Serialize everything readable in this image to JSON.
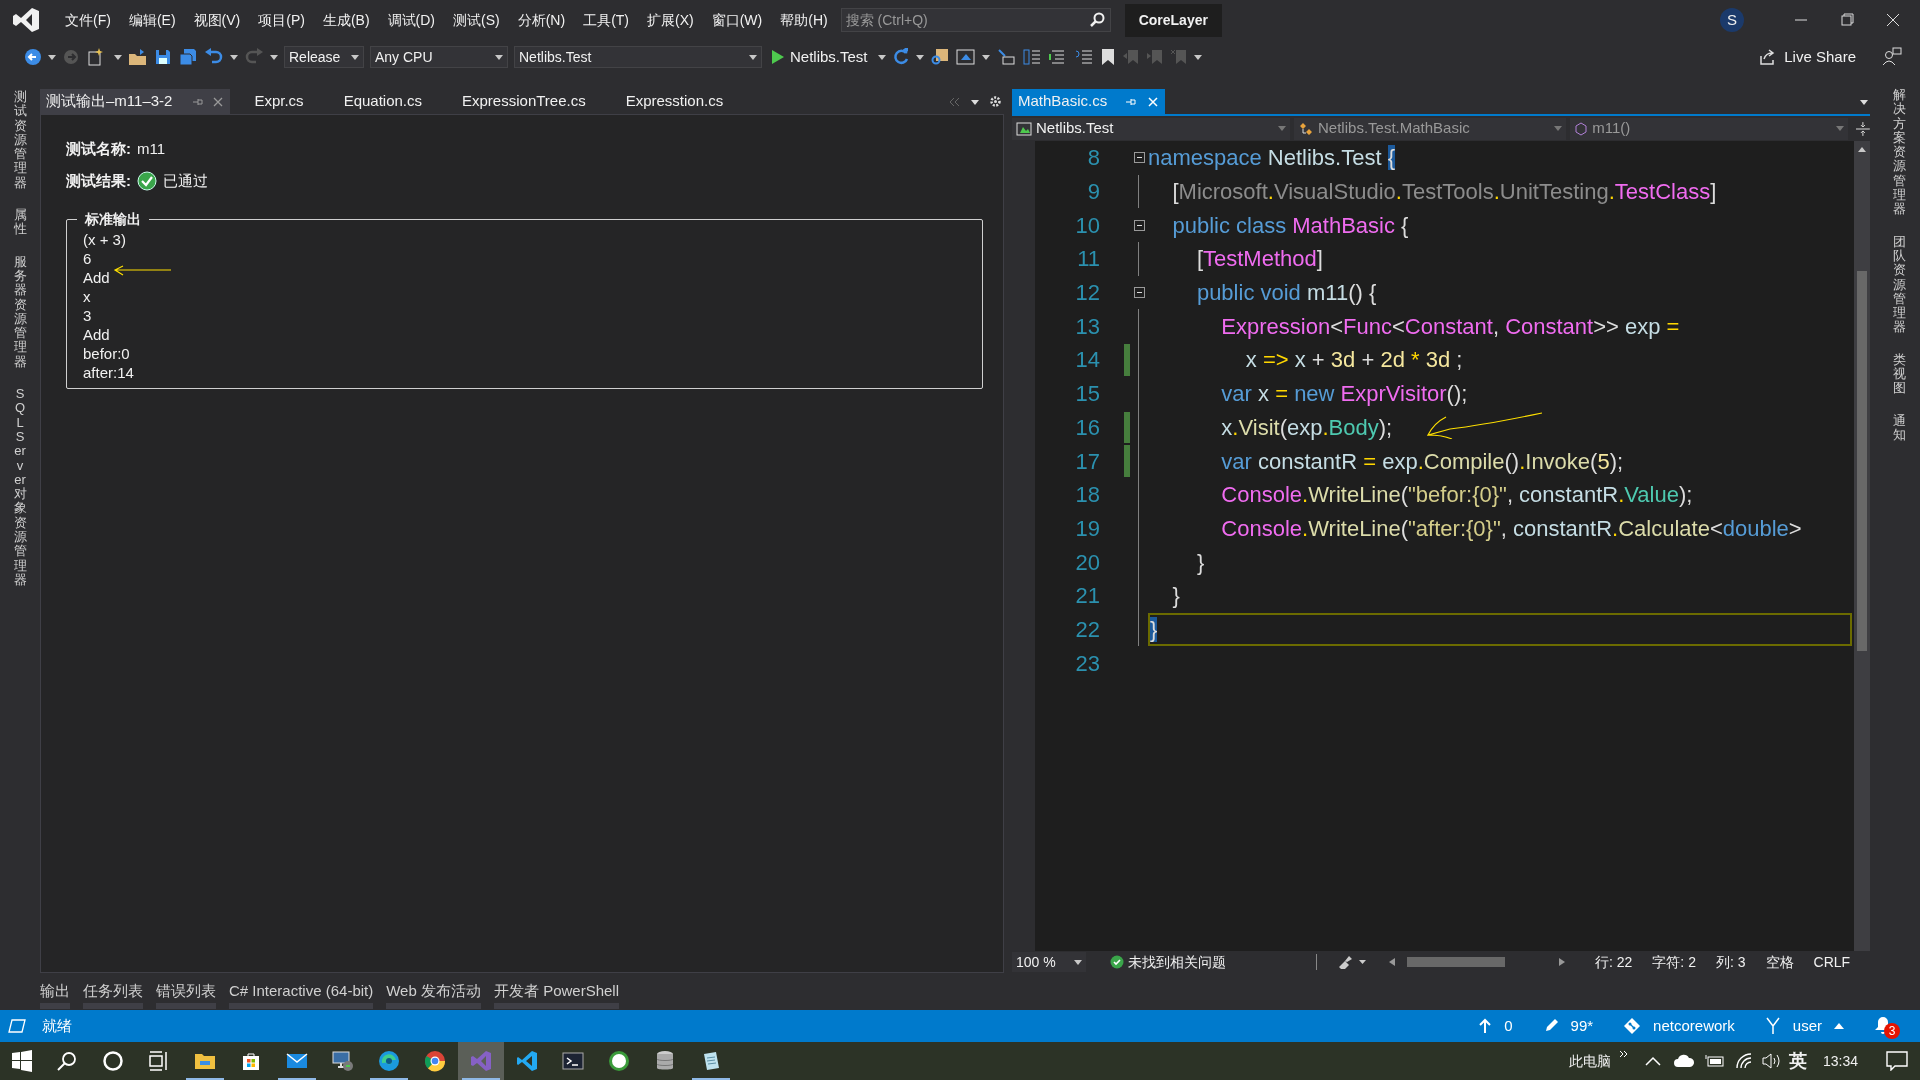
{
  "title_bar": {
    "menu": [
      "文件(F)",
      "编辑(E)",
      "视图(V)",
      "项目(P)",
      "生成(B)",
      "调试(D)",
      "测试(S)",
      "分析(N)",
      "工具(T)",
      "扩展(X)",
      "窗口(W)",
      "帮助(H)"
    ],
    "search": {
      "placeholder": "搜索 (Ctrl+Q)"
    },
    "solution": "CoreLayer",
    "account_initial": "S"
  },
  "toolbar": {
    "configuration": "Release",
    "platform": "Any CPU",
    "startup_project": "Netlibs.Test",
    "run_target": "Netlibs.Test",
    "live_share": "Live Share"
  },
  "left_tool_tabs": [
    "测试资源管理器",
    "属性",
    "服务器资源管理器",
    "SQL Server 对象资源管理器"
  ],
  "right_tool_tabs": [
    "解决方案资源管理器",
    "团队资源管理器",
    "类视图",
    "通知"
  ],
  "output_pane": {
    "tabs": [
      {
        "label": "测试输出–m11–3-2",
        "selected": true
      },
      {
        "label": "Expr.cs",
        "selected": false
      },
      {
        "label": "Equation.cs",
        "selected": false
      },
      {
        "label": "ExpressionTree.cs",
        "selected": false
      },
      {
        "label": "Expresstion.cs",
        "selected": false
      }
    ],
    "test_name": {
      "label": "测试名称:",
      "value": "m11"
    },
    "test_result": {
      "label": "测试结果:",
      "value": "已通过",
      "passed": true
    },
    "stdout": {
      "title": "标准输出",
      "lines": [
        "(x + 3)",
        "6",
        "Add",
        "x",
        "3",
        "Add",
        "befor:0",
        "after:14"
      ]
    }
  },
  "editor": {
    "tabs": [
      {
        "label": "MathBasic.cs",
        "selected": true
      }
    ],
    "nav": [
      {
        "kind": "project",
        "label": "Netlibs.Test"
      },
      {
        "kind": "class",
        "label": "Netlibs.Test.MathBasic"
      },
      {
        "kind": "method",
        "label": "m11()"
      }
    ],
    "lines": [
      {
        "number": "8",
        "fold": true,
        "changed": false,
        "current": false,
        "tokens": [
          {
            "kind": "kw",
            "text": "namespace"
          },
          {
            "kind": "id",
            "text": " Netlibs.Test "
          },
          {
            "kind": "brace",
            "text": "{"
          }
        ]
      },
      {
        "number": "9",
        "fold": false,
        "changed": false,
        "current": false,
        "tokens": [
          {
            "kind": "punct",
            "text": "    ["
          },
          {
            "kind": "ns",
            "text": "Microsoft"
          },
          {
            "kind": "op",
            "text": "."
          },
          {
            "kind": "ns",
            "text": "VisualStudio"
          },
          {
            "kind": "op",
            "text": "."
          },
          {
            "kind": "ns",
            "text": "TestTools"
          },
          {
            "kind": "op",
            "text": "."
          },
          {
            "kind": "ns",
            "text": "UnitTesting"
          },
          {
            "kind": "op",
            "text": "."
          },
          {
            "kind": "type",
            "text": "TestClass"
          },
          {
            "kind": "punct",
            "text": "]"
          }
        ]
      },
      {
        "number": "10",
        "fold": true,
        "changed": false,
        "current": false,
        "tokens": [
          {
            "kind": "kw",
            "text": "    public class "
          },
          {
            "kind": "type",
            "text": "MathBasic"
          },
          {
            "kind": "punct",
            "text": " {"
          }
        ]
      },
      {
        "number": "11",
        "fold": false,
        "changed": false,
        "current": false,
        "tokens": [
          {
            "kind": "punct",
            "text": "        ["
          },
          {
            "kind": "type",
            "text": "TestMethod"
          },
          {
            "kind": "punct",
            "text": "]"
          }
        ]
      },
      {
        "number": "12",
        "fold": true,
        "changed": false,
        "current": false,
        "tokens": [
          {
            "kind": "kw",
            "text": "        public void "
          },
          {
            "kind": "id",
            "text": "m11"
          },
          {
            "kind": "punct",
            "text": "() {"
          }
        ]
      },
      {
        "number": "13",
        "fold": false,
        "changed": false,
        "current": false,
        "tokens": [
          {
            "kind": "type",
            "text": "            Expression"
          },
          {
            "kind": "punct",
            "text": "<"
          },
          {
            "kind": "type",
            "text": "Func"
          },
          {
            "kind": "punct",
            "text": "<"
          },
          {
            "kind": "type",
            "text": "Constant"
          },
          {
            "kind": "punct",
            "text": ", "
          },
          {
            "kind": "type",
            "text": "Constant"
          },
          {
            "kind": "punct",
            "text": ">> "
          },
          {
            "kind": "id",
            "text": "exp "
          },
          {
            "kind": "op",
            "text": "="
          }
        ]
      },
      {
        "number": "14",
        "fold": false,
        "changed": true,
        "current": false,
        "tokens": [
          {
            "kind": "id",
            "text": "                x "
          },
          {
            "kind": "op",
            "text": "=>"
          },
          {
            "kind": "id",
            "text": " x "
          },
          {
            "kind": "punct",
            "text": "+ "
          },
          {
            "kind": "num",
            "text": "3d"
          },
          {
            "kind": "punct",
            "text": " + "
          },
          {
            "kind": "num",
            "text": "2d"
          },
          {
            "kind": "op",
            "text": " * "
          },
          {
            "kind": "num",
            "text": "3d"
          },
          {
            "kind": "punct",
            "text": " ;"
          }
        ]
      },
      {
        "number": "15",
        "fold": false,
        "changed": false,
        "current": false,
        "tokens": [
          {
            "kind": "kw",
            "text": "            var "
          },
          {
            "kind": "id",
            "text": "x "
          },
          {
            "kind": "op",
            "text": "= "
          },
          {
            "kind": "kw",
            "text": "new "
          },
          {
            "kind": "type",
            "text": "ExprVisitor"
          },
          {
            "kind": "punct",
            "text": "();"
          }
        ]
      },
      {
        "number": "16",
        "fold": false,
        "changed": true,
        "current": false,
        "tokens": [
          {
            "kind": "id",
            "text": "            x"
          },
          {
            "kind": "op",
            "text": "."
          },
          {
            "kind": "method",
            "text": "Visit"
          },
          {
            "kind": "punct",
            "text": "("
          },
          {
            "kind": "id",
            "text": "exp"
          },
          {
            "kind": "op",
            "text": "."
          },
          {
            "kind": "prop",
            "text": "Body"
          },
          {
            "kind": "punct",
            "text": ");"
          }
        ]
      },
      {
        "number": "17",
        "fold": false,
        "changed": true,
        "current": false,
        "tokens": [
          {
            "kind": "kw",
            "text": "            var "
          },
          {
            "kind": "id",
            "text": "constantR "
          },
          {
            "kind": "op",
            "text": "= "
          },
          {
            "kind": "id",
            "text": "exp"
          },
          {
            "kind": "op",
            "text": "."
          },
          {
            "kind": "method",
            "text": "Compile"
          },
          {
            "kind": "punct",
            "text": "()"
          },
          {
            "kind": "op",
            "text": "."
          },
          {
            "kind": "method",
            "text": "Invoke"
          },
          {
            "kind": "punct",
            "text": "("
          },
          {
            "kind": "num",
            "text": "5"
          },
          {
            "kind": "punct",
            "text": ");"
          }
        ]
      },
      {
        "number": "18",
        "fold": false,
        "changed": false,
        "current": false,
        "tokens": [
          {
            "kind": "type",
            "text": "            Console"
          },
          {
            "kind": "op",
            "text": "."
          },
          {
            "kind": "method",
            "text": "WriteLine"
          },
          {
            "kind": "punct",
            "text": "("
          },
          {
            "kind": "str",
            "text": "\"befor:{0}\""
          },
          {
            "kind": "punct",
            "text": ", "
          },
          {
            "kind": "id",
            "text": "constantR"
          },
          {
            "kind": "op",
            "text": "."
          },
          {
            "kind": "prop",
            "text": "Value"
          },
          {
            "kind": "punct",
            "text": ");"
          }
        ]
      },
      {
        "number": "19",
        "fold": false,
        "changed": false,
        "current": false,
        "tokens": [
          {
            "kind": "type",
            "text": "            Console"
          },
          {
            "kind": "op",
            "text": "."
          },
          {
            "kind": "method",
            "text": "WriteLine"
          },
          {
            "kind": "punct",
            "text": "("
          },
          {
            "kind": "str",
            "text": "\"after:{0}\""
          },
          {
            "kind": "punct",
            "text": ", "
          },
          {
            "kind": "id",
            "text": "constantR"
          },
          {
            "kind": "op",
            "text": "."
          },
          {
            "kind": "method",
            "text": "Calculate"
          },
          {
            "kind": "punct",
            "text": "<"
          },
          {
            "kind": "kw",
            "text": "double"
          },
          {
            "kind": "punct",
            "text": ">"
          }
        ]
      },
      {
        "number": "20",
        "fold": false,
        "changed": false,
        "current": false,
        "tokens": [
          {
            "kind": "punct",
            "text": "        }"
          }
        ]
      },
      {
        "number": "21",
        "fold": false,
        "changed": false,
        "current": false,
        "tokens": [
          {
            "kind": "punct",
            "text": "    }"
          }
        ]
      },
      {
        "number": "22",
        "fold": false,
        "changed": false,
        "current": true,
        "tokens": [
          {
            "kind": "brace",
            "text": "}"
          }
        ]
      },
      {
        "number": "23",
        "fold": false,
        "changed": false,
        "current": false
      }
    ],
    "zoom": "100 %",
    "issues": "未找到相关问题",
    "position": [
      "行: 22",
      "字符: 2",
      "列: 3",
      "空格",
      "CRLF"
    ]
  },
  "bottom_tabs": [
    "输出",
    "任务列表",
    "错误列表",
    "C# Interactive (64-bit)",
    "Web 发布活动",
    "开发者 PowerShell"
  ],
  "status_bar": {
    "message": "就绪",
    "push_count": "0",
    "changes": "99*",
    "repository": "netcorework",
    "branch": "user",
    "notifications": "3"
  },
  "taskbar": {
    "apps": [
      {
        "kind": "folder",
        "running": true,
        "selected": false
      },
      {
        "kind": "store",
        "running": false,
        "selected": false
      },
      {
        "kind": "mail",
        "running": true,
        "selected": false
      },
      {
        "kind": "remote",
        "running": false,
        "selected": false
      },
      {
        "kind": "browser",
        "running": true,
        "selected": false
      },
      {
        "kind": "chrome",
        "running": false,
        "selected": false
      },
      {
        "kind": "studio",
        "running": true,
        "selected": true
      },
      {
        "kind": "code",
        "running": false,
        "selected": false
      },
      {
        "kind": "terminal",
        "running": false,
        "selected": false
      },
      {
        "kind": "hs",
        "running": false,
        "selected": false
      },
      {
        "kind": "database",
        "running": false,
        "selected": false
      },
      {
        "kind": "notepad",
        "running": true,
        "selected": false
      }
    ],
    "tray": {
      "label": "此电脑",
      "ime": "英",
      "time": "13:34"
    }
  }
}
